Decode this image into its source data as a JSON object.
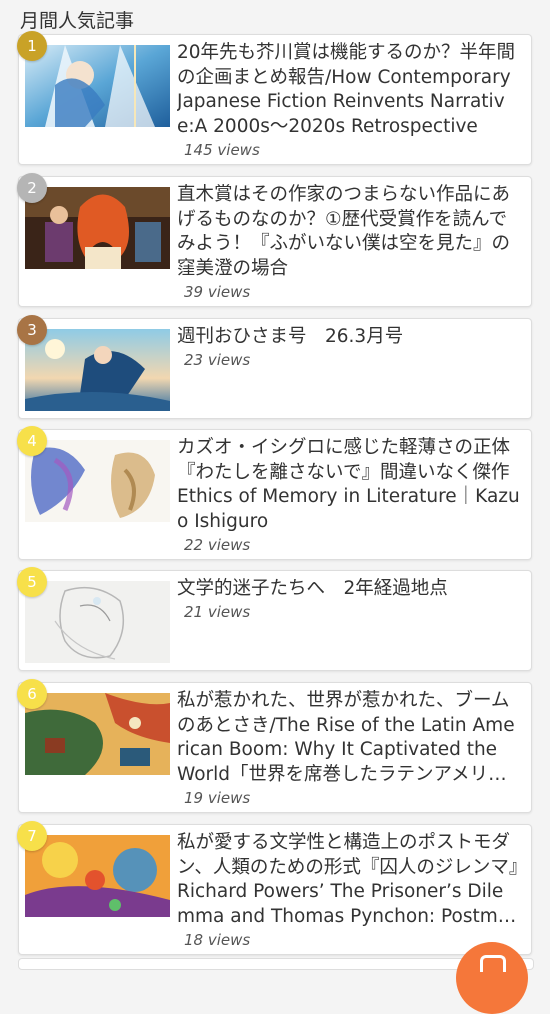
{
  "section": {
    "title": "月間人気記事"
  },
  "articles": [
    {
      "rank": "1",
      "rank_color": "#c9a227",
      "title": "20年先も芥川賞は機能するのか？半年間の企画まとめ報告/How Contemporary Japanese Fiction Reinvents Narrative:A 2000s〜2020s Retrospective",
      "views": "145 views"
    },
    {
      "rank": "2",
      "rank_color": "#b5b5b5",
      "title": "直木賞はその作家のつまらない作品にあげるものなのか？①歴代受賞作を読んでみよう！『ふがいない僕は空を見た』の窪美澄の場合",
      "views": "39 views"
    },
    {
      "rank": "3",
      "rank_color": "#a87445",
      "title": "週刊おひさま号　26.3月号",
      "views": "23 views"
    },
    {
      "rank": "4",
      "rank_color": "#f7e04a",
      "title": "カズオ・イシグロに感じた軽薄さの正体『わたしを離さないで』間違いなく傑作　Ethics of Memory in Literature｜Kazuo Ishiguro",
      "views": "22 views"
    },
    {
      "rank": "5",
      "rank_color": "#f7e04a",
      "title": "文学的迷子たちへ　2年経過地点",
      "views": "21 views"
    },
    {
      "rank": "6",
      "rank_color": "#f7e04a",
      "title": "私が惹かれた、世界が惹かれた、ブームのあとさき/The Rise of the Latin American Boom: Why It Captivated the World「世界を席巻したラテンアメリカ文学」",
      "views": "19 views"
    },
    {
      "rank": "7",
      "rank_color": "#f7e04a",
      "title": "私が愛する文学性と構造上のポストモダン、人類のための形式『囚人のジレンマ』Richard Powers’ The Prisoner’s Dilemma and Thomas Pynchon: Postmodern Structure",
      "views": "18 views"
    }
  ],
  "fab": {
    "icon": "chat-bubble-icon",
    "color": "#f5773a"
  }
}
